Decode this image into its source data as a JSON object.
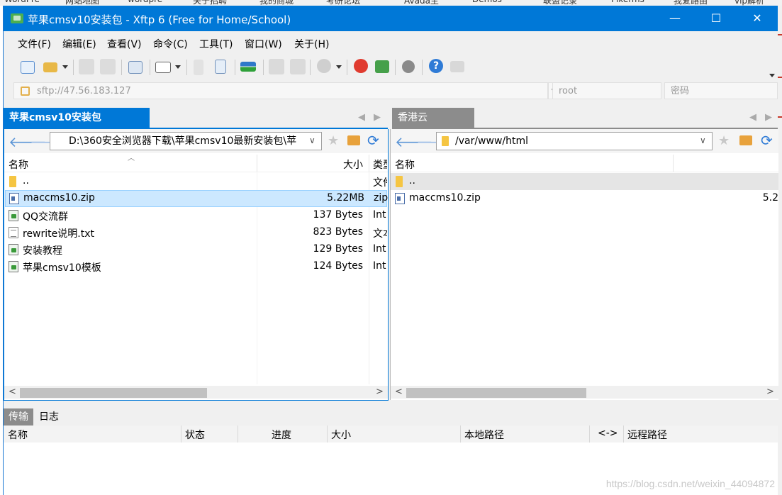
{
  "window": {
    "title": "苹果cmsv10安装包 - Xftp 6 (Free for Home/School)",
    "controls": {
      "minimize": "—",
      "maximize": "☐",
      "close": "✕"
    }
  },
  "menu": [
    "文件(F)",
    "编辑(E)",
    "查看(V)",
    "命令(C)",
    "工具(T)",
    "窗口(W)",
    "关于(H)"
  ],
  "address": {
    "host": "sftp://47.56.183.127",
    "user": "root",
    "password_placeholder": "密码"
  },
  "left_panel": {
    "tab": "苹果cmsv10安装包",
    "path": "D:\\360安全浏览器下载\\苹果cmsv10最新安装包\\苹",
    "columns": {
      "name": "名称",
      "size": "大小",
      "type": "类型"
    },
    "rows": [
      {
        "name": "..",
        "size": "",
        "type": "文件",
        "icon": "folder-icon"
      },
      {
        "name": "maccms10.zip",
        "size": "5.22MB",
        "type": "zip",
        "icon": "zip-file-icon",
        "selected": true
      },
      {
        "name": "QQ交流群",
        "size": "137 Bytes",
        "type": "Int",
        "icon": "internet-shortcut-icon"
      },
      {
        "name": "rewrite说明.txt",
        "size": "823 Bytes",
        "type": "文本",
        "icon": "text-file-icon"
      },
      {
        "name": "安装教程",
        "size": "129 Bytes",
        "type": "Int",
        "icon": "internet-shortcut-icon"
      },
      {
        "name": "苹果cmsv10模板",
        "size": "124 Bytes",
        "type": "Int",
        "icon": "internet-shortcut-icon"
      }
    ]
  },
  "right_panel": {
    "tab": "香港云",
    "path": "/var/www/html",
    "columns": {
      "name": "名称"
    },
    "rows": [
      {
        "name": "..",
        "size": "",
        "icon": "folder-icon",
        "highlighted": true
      },
      {
        "name": "maccms10.zip",
        "size": "5.2",
        "icon": "zip-file-icon"
      }
    ]
  },
  "transfer": {
    "tabs": [
      "传输",
      "日志"
    ],
    "columns": [
      "名称",
      "状态",
      "进度",
      "大小",
      "本地路径",
      "<->",
      "远程路径"
    ]
  },
  "watermark": "https://blog.csdn.net/weixin_44094872",
  "background_bookmarks": [
    "WordPre",
    "网站地图",
    "wordpre",
    "关于招聘",
    "我的商城",
    "考研论坛",
    "Avada主",
    "Demos",
    "联盟记录",
    "Pikerms",
    "我爱路由",
    "vip解析"
  ],
  "colors": {
    "accent": "#0078d7",
    "selection": "#cce8ff",
    "inactive_tab": "#8c8c8c"
  }
}
